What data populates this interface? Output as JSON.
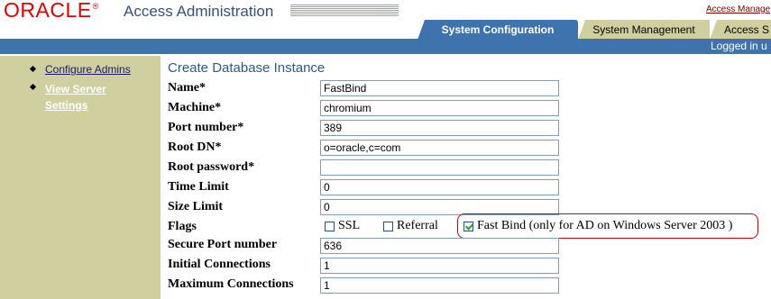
{
  "header": {
    "brand": "ORACLE",
    "title": "Access Administration",
    "access_manager_link": "Access Manage"
  },
  "tabs": [
    {
      "label": "System Configuration",
      "active": true
    },
    {
      "label": "System Management",
      "active": false
    },
    {
      "label": "Access S",
      "active": false
    }
  ],
  "status": {
    "logged_in": "Logged in u"
  },
  "sidebar": {
    "items": [
      {
        "label": "Configure Admins",
        "selected": false
      },
      {
        "label": "View Server Settings",
        "selected": true
      }
    ]
  },
  "form": {
    "title": "Create Database Instance",
    "name": {
      "label": "Name*",
      "value": "FastBind"
    },
    "machine": {
      "label": "Machine*",
      "value": "chromium"
    },
    "port": {
      "label": "Port number*",
      "value": "389"
    },
    "root_dn": {
      "label": "Root DN*",
      "value": "o=oracle,c=com"
    },
    "root_password": {
      "label": "Root password*",
      "value": ""
    },
    "time_limit": {
      "label": "Time Limit",
      "value": "0"
    },
    "size_limit": {
      "label": "Size Limit",
      "value": "0"
    },
    "flags": {
      "label": "Flags",
      "ssl": {
        "label": "SSL",
        "checked": false
      },
      "referral": {
        "label": "Referral",
        "checked": false
      },
      "fast_bind": {
        "label": "Fast Bind (only for AD on Windows Server 2003 )",
        "checked": true
      }
    },
    "secure_port": {
      "label": "Secure Port number",
      "value": "636"
    },
    "initial_connections": {
      "label": "Initial Connections",
      "value": "1"
    },
    "maximum_connections": {
      "label": "Maximum Connections",
      "value": "1"
    }
  },
  "colors": {
    "brand_red": "#e00000",
    "tab_active": "#3f73ad",
    "tab_inactive": "#cfcfa0",
    "sidebar": "#cfcfa0",
    "title_blue": "#2a5a8a",
    "highlight_outline": "#d40000"
  }
}
